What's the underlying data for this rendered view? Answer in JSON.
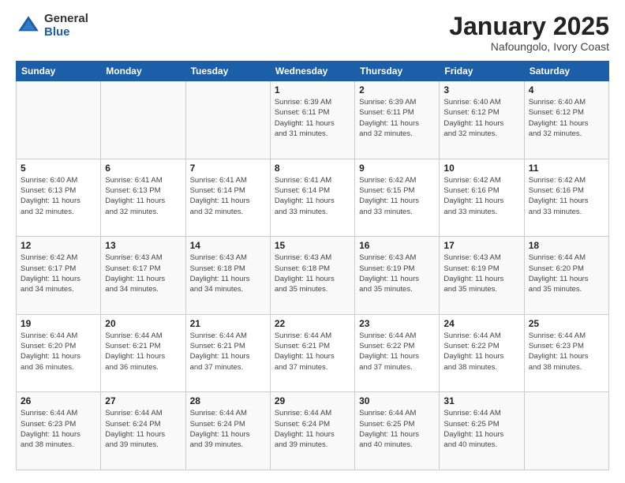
{
  "logo": {
    "general": "General",
    "blue": "Blue"
  },
  "title": "January 2025",
  "subtitle": "Nafoungolo, Ivory Coast",
  "weekdays": [
    "Sunday",
    "Monday",
    "Tuesday",
    "Wednesday",
    "Thursday",
    "Friday",
    "Saturday"
  ],
  "weeks": [
    [
      {
        "day": "",
        "info": ""
      },
      {
        "day": "",
        "info": ""
      },
      {
        "day": "",
        "info": ""
      },
      {
        "day": "1",
        "info": "Sunrise: 6:39 AM\nSunset: 6:11 PM\nDaylight: 11 hours\nand 31 minutes."
      },
      {
        "day": "2",
        "info": "Sunrise: 6:39 AM\nSunset: 6:11 PM\nDaylight: 11 hours\nand 32 minutes."
      },
      {
        "day": "3",
        "info": "Sunrise: 6:40 AM\nSunset: 6:12 PM\nDaylight: 11 hours\nand 32 minutes."
      },
      {
        "day": "4",
        "info": "Sunrise: 6:40 AM\nSunset: 6:12 PM\nDaylight: 11 hours\nand 32 minutes."
      }
    ],
    [
      {
        "day": "5",
        "info": "Sunrise: 6:40 AM\nSunset: 6:13 PM\nDaylight: 11 hours\nand 32 minutes."
      },
      {
        "day": "6",
        "info": "Sunrise: 6:41 AM\nSunset: 6:13 PM\nDaylight: 11 hours\nand 32 minutes."
      },
      {
        "day": "7",
        "info": "Sunrise: 6:41 AM\nSunset: 6:14 PM\nDaylight: 11 hours\nand 32 minutes."
      },
      {
        "day": "8",
        "info": "Sunrise: 6:41 AM\nSunset: 6:14 PM\nDaylight: 11 hours\nand 33 minutes."
      },
      {
        "day": "9",
        "info": "Sunrise: 6:42 AM\nSunset: 6:15 PM\nDaylight: 11 hours\nand 33 minutes."
      },
      {
        "day": "10",
        "info": "Sunrise: 6:42 AM\nSunset: 6:16 PM\nDaylight: 11 hours\nand 33 minutes."
      },
      {
        "day": "11",
        "info": "Sunrise: 6:42 AM\nSunset: 6:16 PM\nDaylight: 11 hours\nand 33 minutes."
      }
    ],
    [
      {
        "day": "12",
        "info": "Sunrise: 6:42 AM\nSunset: 6:17 PM\nDaylight: 11 hours\nand 34 minutes."
      },
      {
        "day": "13",
        "info": "Sunrise: 6:43 AM\nSunset: 6:17 PM\nDaylight: 11 hours\nand 34 minutes."
      },
      {
        "day": "14",
        "info": "Sunrise: 6:43 AM\nSunset: 6:18 PM\nDaylight: 11 hours\nand 34 minutes."
      },
      {
        "day": "15",
        "info": "Sunrise: 6:43 AM\nSunset: 6:18 PM\nDaylight: 11 hours\nand 35 minutes."
      },
      {
        "day": "16",
        "info": "Sunrise: 6:43 AM\nSunset: 6:19 PM\nDaylight: 11 hours\nand 35 minutes."
      },
      {
        "day": "17",
        "info": "Sunrise: 6:43 AM\nSunset: 6:19 PM\nDaylight: 11 hours\nand 35 minutes."
      },
      {
        "day": "18",
        "info": "Sunrise: 6:44 AM\nSunset: 6:20 PM\nDaylight: 11 hours\nand 35 minutes."
      }
    ],
    [
      {
        "day": "19",
        "info": "Sunrise: 6:44 AM\nSunset: 6:20 PM\nDaylight: 11 hours\nand 36 minutes."
      },
      {
        "day": "20",
        "info": "Sunrise: 6:44 AM\nSunset: 6:21 PM\nDaylight: 11 hours\nand 36 minutes."
      },
      {
        "day": "21",
        "info": "Sunrise: 6:44 AM\nSunset: 6:21 PM\nDaylight: 11 hours\nand 37 minutes."
      },
      {
        "day": "22",
        "info": "Sunrise: 6:44 AM\nSunset: 6:21 PM\nDaylight: 11 hours\nand 37 minutes."
      },
      {
        "day": "23",
        "info": "Sunrise: 6:44 AM\nSunset: 6:22 PM\nDaylight: 11 hours\nand 37 minutes."
      },
      {
        "day": "24",
        "info": "Sunrise: 6:44 AM\nSunset: 6:22 PM\nDaylight: 11 hours\nand 38 minutes."
      },
      {
        "day": "25",
        "info": "Sunrise: 6:44 AM\nSunset: 6:23 PM\nDaylight: 11 hours\nand 38 minutes."
      }
    ],
    [
      {
        "day": "26",
        "info": "Sunrise: 6:44 AM\nSunset: 6:23 PM\nDaylight: 11 hours\nand 38 minutes."
      },
      {
        "day": "27",
        "info": "Sunrise: 6:44 AM\nSunset: 6:24 PM\nDaylight: 11 hours\nand 39 minutes."
      },
      {
        "day": "28",
        "info": "Sunrise: 6:44 AM\nSunset: 6:24 PM\nDaylight: 11 hours\nand 39 minutes."
      },
      {
        "day": "29",
        "info": "Sunrise: 6:44 AM\nSunset: 6:24 PM\nDaylight: 11 hours\nand 39 minutes."
      },
      {
        "day": "30",
        "info": "Sunrise: 6:44 AM\nSunset: 6:25 PM\nDaylight: 11 hours\nand 40 minutes."
      },
      {
        "day": "31",
        "info": "Sunrise: 6:44 AM\nSunset: 6:25 PM\nDaylight: 11 hours\nand 40 minutes."
      },
      {
        "day": "",
        "info": ""
      }
    ]
  ]
}
